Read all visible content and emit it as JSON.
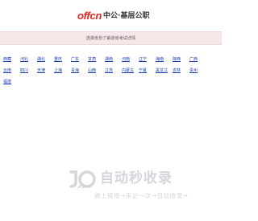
{
  "header": {
    "logo_offcn": "offcn",
    "logo_cn": "中公·基层公职",
    "brand_color": "#e02525"
  },
  "notice": {
    "text": "选择省份了解该省考试详情"
  },
  "provinces": {
    "row1": [
      "西藏",
      "河北",
      "湖北",
      "重庆",
      "广东",
      "甘肃",
      "湖南",
      "河南",
      "辽宁",
      "海南",
      "陕西",
      "广西"
    ],
    "row2": [
      "云南",
      "四川",
      "天津",
      "上海",
      "青海",
      "山西",
      "江苏",
      "内蒙古",
      "宁夏",
      "黑龙江",
      "吉林",
      "贵州"
    ],
    "row3": [
      "福建"
    ],
    "link_color": "#1a3bb5"
  },
  "watermark": {
    "title": "自动秒收录",
    "subtitle": "做上链接→来访一次→自动收录→",
    "color": "#d3d6db"
  }
}
